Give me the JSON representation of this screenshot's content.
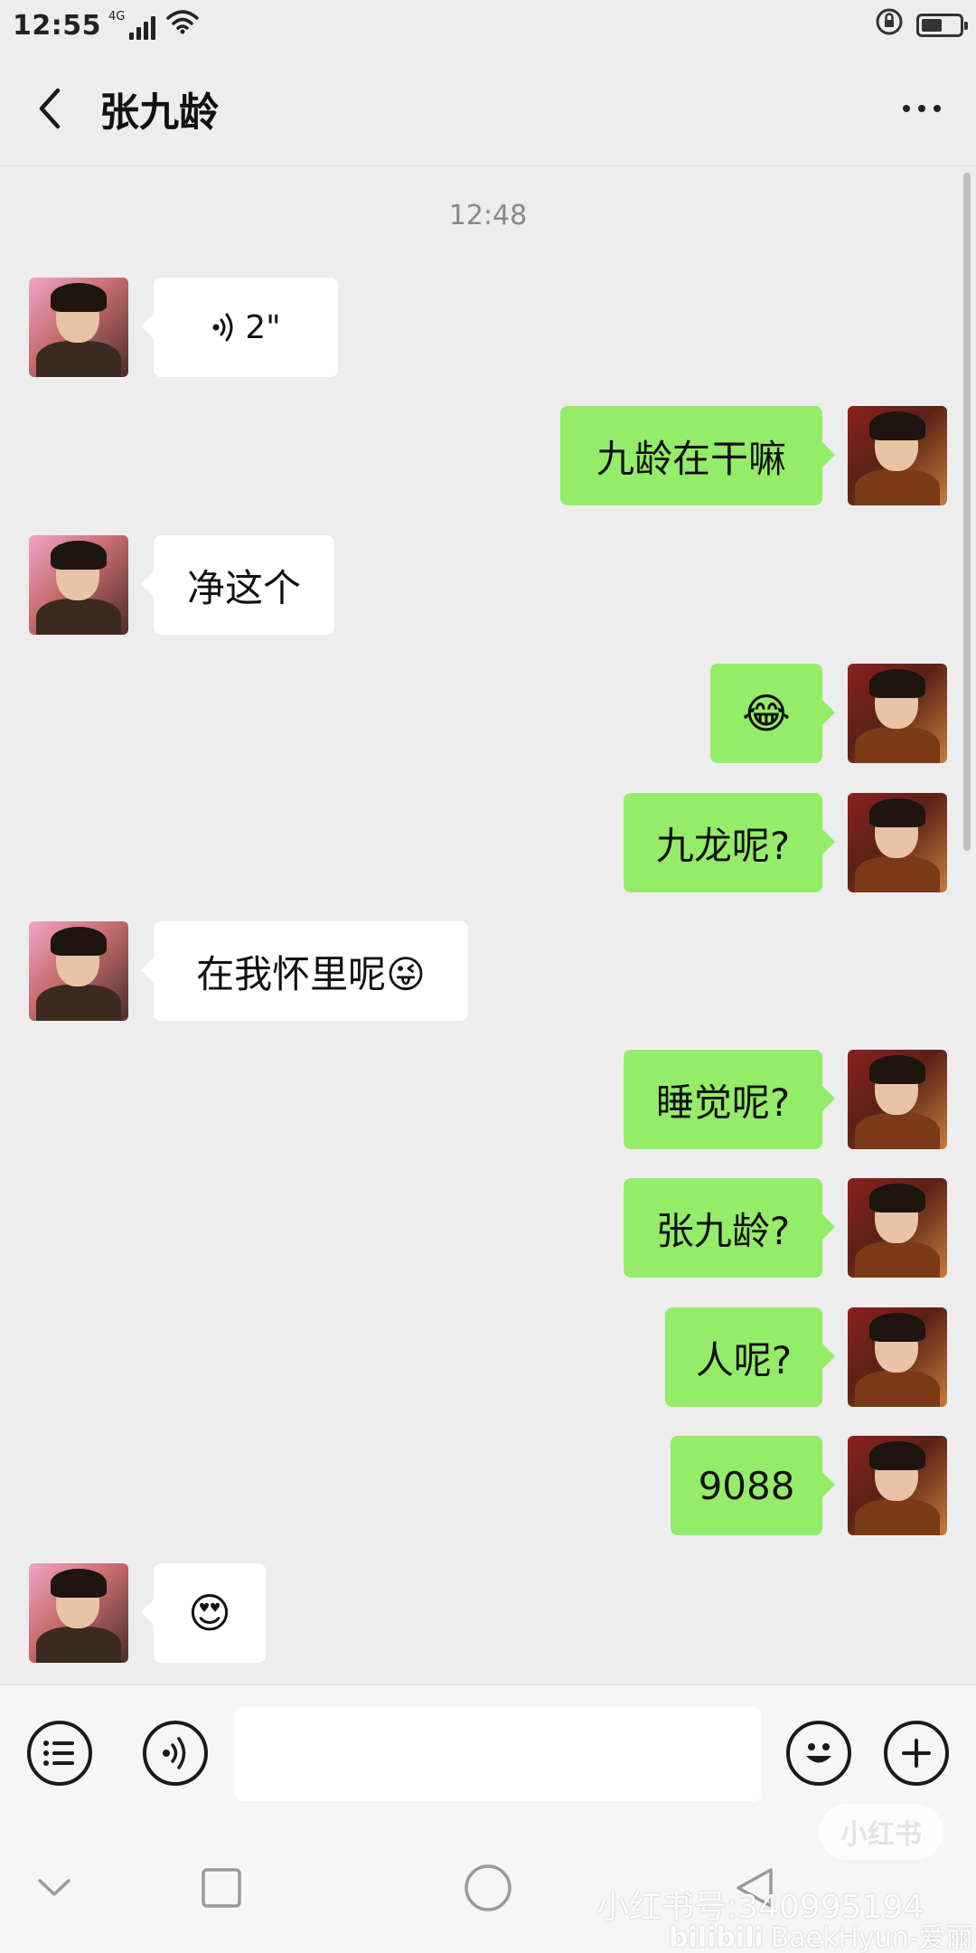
{
  "status_bar": {
    "time": "12:55",
    "network_label": "4G"
  },
  "header": {
    "title": "张九龄"
  },
  "chat": {
    "timestamp": "12:48",
    "messages": [
      {
        "side": "left",
        "type": "voice",
        "text": "2\""
      },
      {
        "side": "right",
        "type": "text",
        "text": "九龄在干嘛"
      },
      {
        "side": "left",
        "type": "text",
        "text": "净这个"
      },
      {
        "side": "right",
        "type": "emoji",
        "text": "😂"
      },
      {
        "side": "right",
        "type": "text",
        "text": "九龙呢?"
      },
      {
        "side": "left",
        "type": "text",
        "text": "在我怀里呢😜"
      },
      {
        "side": "right",
        "type": "text",
        "text": "睡觉呢?"
      },
      {
        "side": "right",
        "type": "text",
        "text": "张九龄?"
      },
      {
        "side": "right",
        "type": "text",
        "text": "人呢?"
      },
      {
        "side": "right",
        "type": "text",
        "text": "9088"
      },
      {
        "side": "left",
        "type": "emoji",
        "text": "😍"
      }
    ]
  },
  "input_bar": {
    "value": "",
    "icons": [
      "list-icon",
      "voice-icon",
      "emoji-icon",
      "plus-icon"
    ]
  },
  "nav_bar": {
    "icons": [
      "chevron-down-icon",
      "square-icon",
      "circle-icon",
      "triangle-back-icon"
    ]
  },
  "watermarks": {
    "logo": "小红书",
    "id": "小红书号:340995194",
    "bilibili": "BaekHyun-爱丽"
  },
  "colors": {
    "background": "#ededed",
    "sent_bubble": "#95ec69",
    "received_bubble": "#ffffff"
  }
}
